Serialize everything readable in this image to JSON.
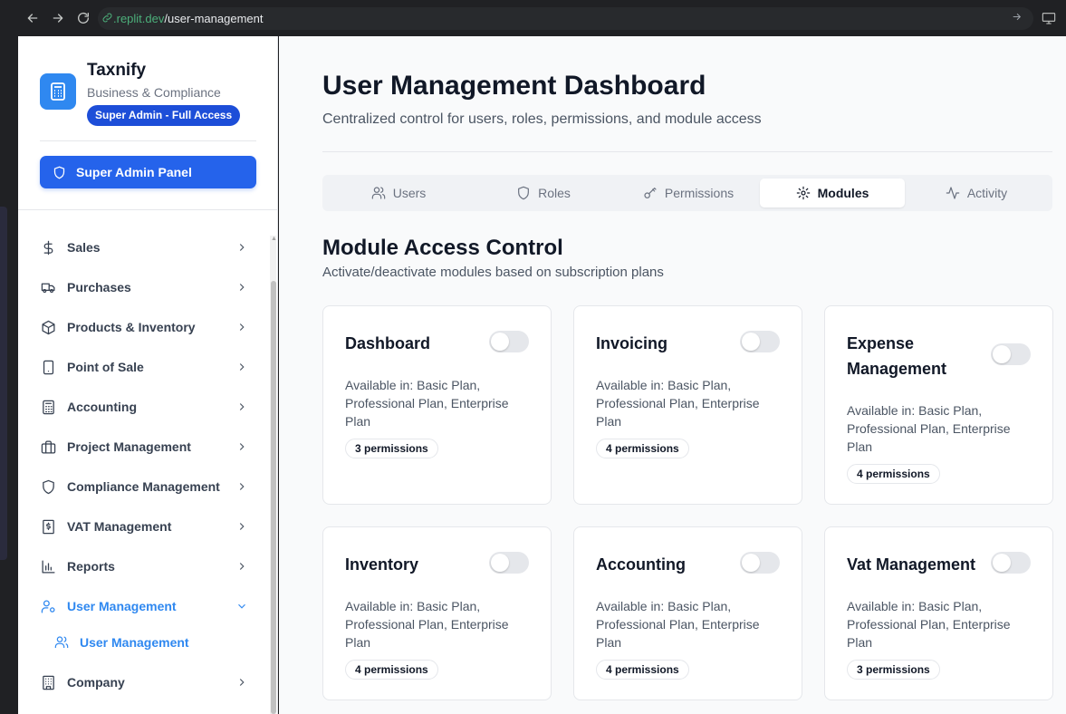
{
  "browser": {
    "url_host": ".replit.dev",
    "url_path": "/user-management"
  },
  "sidebar": {
    "brand_name": "Taxnify",
    "brand_sub": "Business & Compliance",
    "role_badge": "Super Admin - Full Access",
    "admin_panel_label": "Super Admin Panel",
    "items": [
      {
        "label": "Sales",
        "icon": "dollar-icon"
      },
      {
        "label": "Purchases",
        "icon": "truck-icon"
      },
      {
        "label": "Products & Inventory",
        "icon": "package-icon"
      },
      {
        "label": "Point of Sale",
        "icon": "tablet-icon"
      },
      {
        "label": "Accounting",
        "icon": "calculator-icon"
      },
      {
        "label": "Project Management",
        "icon": "briefcase-icon"
      },
      {
        "label": "Compliance Management",
        "icon": "shield-icon"
      },
      {
        "label": "VAT Management",
        "icon": "receipt-icon"
      },
      {
        "label": "Reports",
        "icon": "bar-chart-icon"
      },
      {
        "label": "User Management",
        "icon": "user-cog-icon"
      },
      {
        "label": "Company",
        "icon": "building-icon"
      }
    ],
    "sub_item_label": "User Management"
  },
  "main": {
    "title": "User Management Dashboard",
    "subtitle": "Centralized control for users, roles, permissions, and module access",
    "tabs": [
      {
        "label": "Users",
        "icon": "users-icon"
      },
      {
        "label": "Roles",
        "icon": "shield-icon"
      },
      {
        "label": "Permissions",
        "icon": "key-icon"
      },
      {
        "label": "Modules",
        "icon": "gear-icon"
      },
      {
        "label": "Activity",
        "icon": "activity-icon"
      }
    ],
    "active_tab": "Modules",
    "section_title": "Module Access Control",
    "section_sub": "Activate/deactivate modules based on subscription plans",
    "modules": [
      {
        "name": "Dashboard",
        "available": "Available in: Basic Plan, Professional Plan, Enterprise Plan",
        "permissions": "3 permissions",
        "enabled": false
      },
      {
        "name": "Invoicing",
        "available": "Available in: Basic Plan, Professional Plan, Enterprise Plan",
        "permissions": "4 permissions",
        "enabled": false
      },
      {
        "name": "Expense Management",
        "available": "Available in: Basic Plan, Professional Plan, Enterprise Plan",
        "permissions": "4 permissions",
        "enabled": false
      },
      {
        "name": "Inventory",
        "available": "Available in: Basic Plan, Professional Plan, Enterprise Plan",
        "permissions": "4 permissions",
        "enabled": false
      },
      {
        "name": "Accounting",
        "available": "Available in: Basic Plan, Professional Plan, Enterprise Plan",
        "permissions": "4 permissions",
        "enabled": false
      },
      {
        "name": "Vat Management",
        "available": "Available in: Basic Plan, Professional Plan, Enterprise Plan",
        "permissions": "3 permissions",
        "enabled": false
      }
    ]
  },
  "colors": {
    "accent": "#2563eb",
    "active_nav": "#2f88f0",
    "toggle_off": "#e5e7eb"
  }
}
